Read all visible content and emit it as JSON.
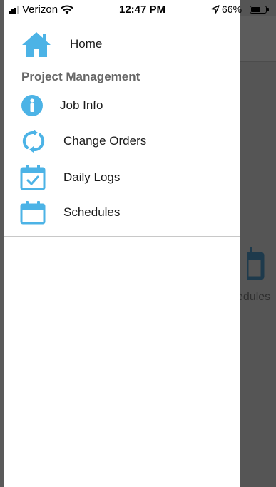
{
  "status_bar": {
    "carrier": "Verizon",
    "time": "12:47 PM",
    "battery": "66%",
    "battery_level": 0.66,
    "signal_icon": "signal-bars-icon",
    "wifi_icon": "wifi-icon",
    "location_icon": "location-arrow-icon"
  },
  "drawer": {
    "home": {
      "label": "Home",
      "icon": "home-icon"
    },
    "section_title": "Project Management",
    "items": [
      {
        "label": "Job Info",
        "icon": "info-icon"
      },
      {
        "label": "Change Orders",
        "icon": "refresh-icon"
      },
      {
        "label": "Daily Logs",
        "icon": "calendar-check-icon"
      },
      {
        "label": "Schedules",
        "icon": "calendar-icon"
      }
    ]
  },
  "background": {
    "tile_label": "edules",
    "tile_icon": "calendar-icon"
  },
  "colors": {
    "icon_blue": "#4cb3e6",
    "overlay": "#4a4a4a",
    "section_gray": "#666666"
  }
}
